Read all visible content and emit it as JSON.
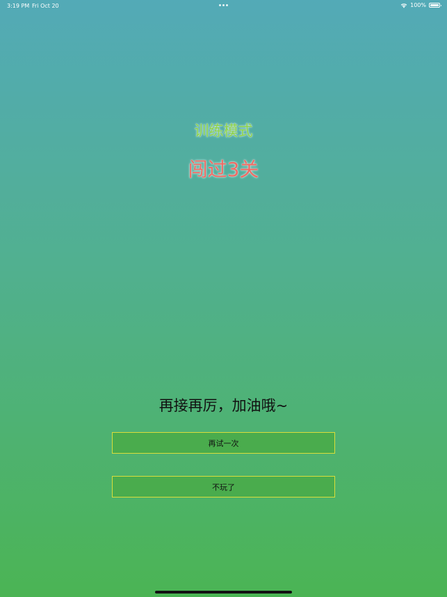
{
  "status_bar": {
    "time": "3:19 PM",
    "date": "Fri Oct 20",
    "battery": "100%",
    "wifi_icon": "wifi-icon",
    "battery_icon": "battery-icon"
  },
  "result": {
    "mode_title": "训练模式",
    "level_result": "闯过3关"
  },
  "message": {
    "encourage": "再接再厉，加油哦~"
  },
  "actions": {
    "retry_label": "再试一次",
    "quit_label": "不玩了"
  },
  "colors": {
    "mode_title": "#8bd24a",
    "level_result": "#ee6b64",
    "button_fill": "#4aac4d",
    "button_border": "#d9de3b"
  }
}
